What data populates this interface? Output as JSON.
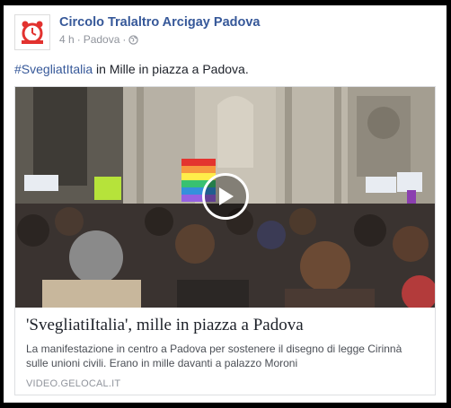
{
  "post": {
    "page_name": "Circolo Tralaltro Arcigay Padova",
    "time": "4 h",
    "separator": "·",
    "location": "Padova",
    "separator2": "·",
    "privacy_icon": "globe-icon",
    "text_hashtag": "#SvegliatItalia",
    "text_rest": " in Mille in piazza a Padova."
  },
  "link_card": {
    "title": "'SvegliatiItalia', mille in piazza a Padova",
    "description": "La manifestazione in centro a Padova per sostenere il disegno di legge Cirinnà sulle unioni civili. Erano in mille davanti a palazzo Moroni",
    "source": "VIDEO.GELOCAL.IT",
    "play_icon": "play-icon"
  },
  "colors": {
    "link_blue": "#365899",
    "avatar_red": "#e2322f"
  }
}
